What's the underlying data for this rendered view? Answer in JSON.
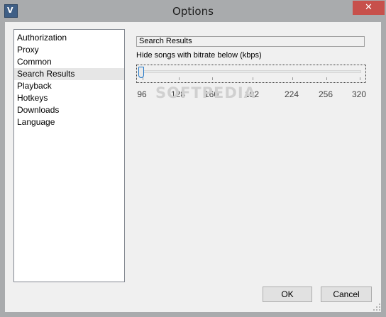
{
  "window": {
    "title": "Options",
    "close_symbol": "✕",
    "app_icon": "app-logo-icon",
    "app_icon_glyph": "V"
  },
  "nav": {
    "items": [
      {
        "label": "Authorization"
      },
      {
        "label": "Proxy"
      },
      {
        "label": "Common"
      },
      {
        "label": "Search Results",
        "selected": true
      },
      {
        "label": "Playback"
      },
      {
        "label": "Hotkeys"
      },
      {
        "label": "Downloads"
      },
      {
        "label": "Language"
      }
    ]
  },
  "panel": {
    "group_title": "Search Results",
    "slider_label": "Hide songs with bitrate below (kbps)",
    "slider": {
      "min": 96,
      "max": 320,
      "value": 96,
      "tick_labels": [
        "96",
        "128",
        "160",
        "192",
        "224",
        "256",
        "320"
      ]
    },
    "watermark": "SOFTPEDIA"
  },
  "buttons": {
    "ok": "OK",
    "cancel": "Cancel"
  },
  "colors": {
    "close": "#c7504b",
    "thumb_border": "#1c75c9",
    "selected_item": "#e6e6e6"
  }
}
